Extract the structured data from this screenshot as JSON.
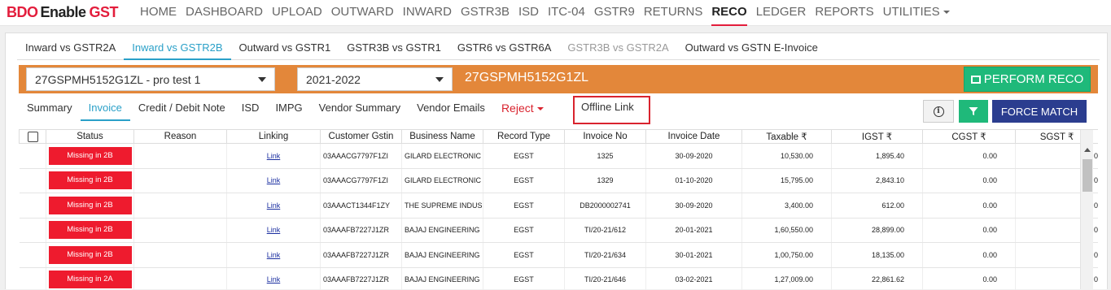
{
  "logo": {
    "part1": "BDO",
    "part2": "Enable",
    "part3": "GST"
  },
  "nav": {
    "items": [
      "HOME",
      "DASHBOARD",
      "UPLOAD",
      "OUTWARD",
      "INWARD",
      "GSTR3B",
      "ISD",
      "ITC-04",
      "GSTR9",
      "RETURNS",
      "RECO",
      "LEDGER",
      "REPORTS",
      "UTILITIES"
    ],
    "active": "RECO"
  },
  "reco_tabs": [
    "Inward vs GSTR2A",
    "Inward vs GSTR2B",
    "Outward vs GSTR1",
    "GSTR3B vs GSTR1",
    "GSTR6 vs GSTR6A",
    "GSTR3B vs GSTR2A",
    "Outward vs GSTN E-Invoice"
  ],
  "filters": {
    "gstin_select": "27GSPMH5152G1ZL - pro test 1",
    "year_select": "2021-2022",
    "gstin_title": "27GSPMH5152G1ZL",
    "perform_reco": "PERFORM RECO"
  },
  "sub_tabs": [
    "Summary",
    "Invoice",
    "Credit / Debit Note",
    "ISD",
    "IMPG",
    "Vendor Summary",
    "Vendor Emails"
  ],
  "reject_label": "Reject",
  "offline_link": "Offline Link",
  "actions": {
    "info_icon": "info-icon",
    "filter_icon": "filter-icon",
    "force_match": "FORCE MATCH"
  },
  "colors": {
    "brand_red": "#e31d3c",
    "orange_bar": "#e3873a",
    "green": "#1fb97a",
    "navy": "#2b3d8f",
    "badge_red": "#ee1b2e",
    "tab_blue": "#2aa0c8"
  },
  "table": {
    "headers": [
      "Status",
      "Reason",
      "Linking",
      "Customer Gstin",
      "Business Name",
      "Record Type",
      "Invoice No",
      "Invoice Date",
      "Taxable ₹",
      "IGST ₹",
      "CGST ₹",
      "SGST ₹"
    ],
    "rows": [
      [
        "Missing in 2B",
        "",
        "Link",
        "03AAACG7797F1ZI",
        "GILARD ELECTRONIC",
        "EGST",
        "1325",
        "30-09-2020",
        "10,530.00",
        "1,895.40",
        "0.00",
        "0"
      ],
      [
        "Missing in 2B",
        "",
        "Link",
        "03AAACG7797F1ZI",
        "GILARD ELECTRONIC",
        "EGST",
        "1329",
        "01-10-2020",
        "15,795.00",
        "2,843.10",
        "0.00",
        "0"
      ],
      [
        "Missing in 2B",
        "",
        "Link",
        "03AAACT1344F1ZY",
        "THE SUPREME INDUS",
        "EGST",
        "DB2000002741",
        "30-09-2020",
        "3,400.00",
        "612.00",
        "0.00",
        "0"
      ],
      [
        "Missing in 2B",
        "",
        "Link",
        "03AAAFB7227J1ZR",
        "BAJAJ ENGINEERING",
        "EGST",
        "TI/20-21/612",
        "20-01-2021",
        "1,60,550.00",
        "28,899.00",
        "0.00",
        "0"
      ],
      [
        "Missing in 2B",
        "",
        "Link",
        "03AAAFB7227J1ZR",
        "BAJAJ ENGINEERING",
        "EGST",
        "TI/20-21/634",
        "30-01-2021",
        "1,00,750.00",
        "18,135.00",
        "0.00",
        "0"
      ],
      [
        "Missing in 2A",
        "",
        "Link",
        "03AAAFB7227J1ZR",
        "BAJAJ ENGINEERING",
        "EGST",
        "TI/20-21/646",
        "03-02-2021",
        "1,27,009.00",
        "22,861.62",
        "0.00",
        "0"
      ]
    ]
  }
}
